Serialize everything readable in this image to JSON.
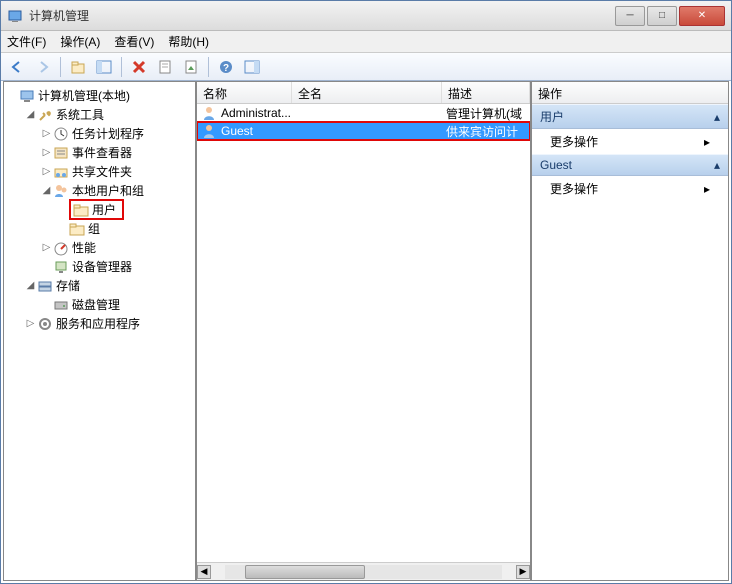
{
  "window": {
    "title": "计算机管理"
  },
  "menu": {
    "file": "文件(F)",
    "action": "操作(A)",
    "view": "查看(V)",
    "help": "帮助(H)"
  },
  "tree": {
    "root": "计算机管理(本地)",
    "system_tools": "系统工具",
    "task_scheduler": "任务计划程序",
    "event_viewer": "事件查看器",
    "shared_folders": "共享文件夹",
    "local_users_groups": "本地用户和组",
    "users": "用户",
    "groups": "组",
    "performance": "性能",
    "device_manager": "设备管理器",
    "storage": "存储",
    "disk_management": "磁盘管理",
    "services_apps": "服务和应用程序"
  },
  "list": {
    "columns": {
      "name": "名称",
      "fullname": "全名",
      "description": "描述"
    },
    "rows": [
      {
        "name": "Administrat...",
        "fullname": "",
        "desc": "管理计算机(域"
      },
      {
        "name": "Guest",
        "fullname": "",
        "desc": "供来宾访问计"
      }
    ]
  },
  "actions": {
    "title": "操作",
    "group1": "用户",
    "more_actions": "更多操作",
    "group2": "Guest"
  }
}
